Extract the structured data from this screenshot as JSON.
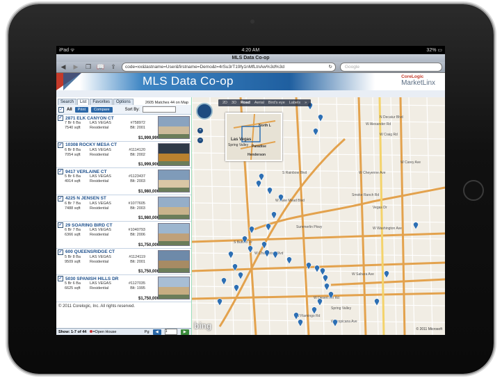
{
  "device": {
    "status_left": "iPad ᯤ",
    "status_time": "4:20 AM",
    "status_right": "32% ▭",
    "page_title": "MLS Data Co-op",
    "url": "code=xx&lastname=User&firstname=Demo&t=4rSu3rT19fy1nMfLtnAw%3d%3d",
    "search_placeholder": "Google"
  },
  "header": {
    "title": "MLS Data Co-op",
    "logo_line1": "CoreLogic",
    "logo_line2": "MarketLinx"
  },
  "sidebar": {
    "tabs": [
      "Search",
      "List",
      "Favorites",
      "Options"
    ],
    "matches": "2605 Matches 44 on Map",
    "all_label": "All",
    "print_label": "Print",
    "compare_label": "Compare",
    "sortby_label": "Sort By:",
    "listings": [
      {
        "address": "2871 ELK CANYON CT",
        "beds_baths": "7 Br 6 Ba",
        "sqft": "7540 sqft",
        "city": "LAS VEGAS",
        "type": "Residential",
        "mls": "#758972",
        "built": "Blt: 2001",
        "price": "$1,999,999"
      },
      {
        "address": "10308 ROCKY MESA CT",
        "beds_baths": "6 Br 8 Ba",
        "sqft": "7054 sqft",
        "city": "LAS VEGAS",
        "type": "Residential",
        "mls": "#1114120",
        "built": "Blt: 2002",
        "price": "$1,999,900"
      },
      {
        "address": "9417 VERLAINE CT",
        "beds_baths": "5 Br 6 Ba",
        "sqft": "4914 sqft",
        "city": "LAS VEGAS",
        "type": "Residential",
        "mls": "#1123437",
        "built": "Blt: 2003",
        "price": "$1,980,000"
      },
      {
        "address": "4225 N JENSEN ST",
        "beds_baths": "6 Br 7 Ba",
        "sqft": "7488 sqft",
        "city": "LAS VEGAS",
        "type": "Residential",
        "mls": "#1077605",
        "built": "Blt: 2003",
        "price": "$1,980,000"
      },
      {
        "address": "29 SOARING BIRD CT",
        "beds_baths": "6 Br 7 Ba",
        "sqft": "6366 sqft",
        "city": "LAS VEGAS",
        "type": "Residential",
        "mls": "#1040793",
        "built": "Blt: 2006",
        "price": "$1,750,000"
      },
      {
        "address": "600 QUEENSRIDGE CT",
        "beds_baths": "5 Br 8 Ba",
        "sqft": "9509 sqft",
        "city": "LAS VEGAS",
        "type": "Residential",
        "mls": "#1124119",
        "built": "Blt: 2001",
        "price": "$1,750,000"
      },
      {
        "address": "5030 SPANISH HILLS DR",
        "beds_baths": "5 Br 6 Ba",
        "sqft": "6625 sqft",
        "city": "LAS VEGAS",
        "type": "Residential",
        "mls": "#1127035",
        "built": "Blt: 1995",
        "price": "$1,750,000"
      }
    ],
    "copyright": "© 2011 Corelogic, Inc. All rights reserved.",
    "show_label": "Show: 1-7 of 44",
    "open_house_label": "=Open House",
    "pg_label": "Pg",
    "page_value": "1"
  },
  "map": {
    "view_tabs": [
      "2D",
      "3D",
      "Road",
      "Aerial",
      "Bird's eye",
      "Labels",
      "»"
    ],
    "active_tab": "Road",
    "inset_labels": [
      "Las Vegas",
      "North L",
      "Paradise",
      "Henderson",
      "Spring Valley"
    ],
    "street_labels": [
      "W Craig Rd",
      "W Alexander Rd",
      "W Cheyenne Ave",
      "W Carey Ave",
      "Smoke Ranch Rd",
      "W Lake Mead Blvd",
      "Vegas Dr",
      "W Washington Ave",
      "W Charleston Blvd",
      "W Sahara Ave",
      "W Desert Inn Rd",
      "W Flamingo Rd",
      "W Tropicana Ave",
      "Summerlin Pkwy",
      "Spring Valley",
      "N Decatur Blvd",
      "S Rainbow Blvd",
      "S Buffalo Dr"
    ],
    "brand": "bing",
    "scale_text": "© 2011 Microsoft"
  },
  "colors": {
    "accent": "#2a67a8",
    "banner": "#1f5fa0",
    "brand_red": "#c43a2a",
    "pin": "#2d6fb3",
    "road_major": "#e3a24d"
  }
}
